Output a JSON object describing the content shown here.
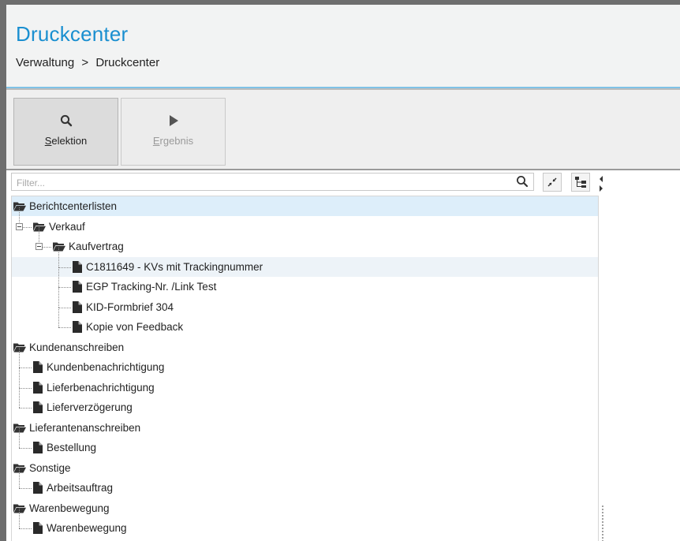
{
  "header": {
    "title": "Druckcenter",
    "breadcrumb": [
      "Verwaltung",
      ">",
      "Druckcenter"
    ]
  },
  "toolbar": {
    "selektion": {
      "underlined": "S",
      "rest": "elektion",
      "icon": "search-icon"
    },
    "ergebnis": {
      "underlined": "E",
      "rest": "rgebnis",
      "icon": "play-icon"
    }
  },
  "filter": {
    "placeholder": "Filter..."
  },
  "tree": {
    "nodes": [
      {
        "id": "berichtcenterlisten",
        "label": "Berichtcenterlisten",
        "type": "folder",
        "level": 0,
        "selected": true
      },
      {
        "id": "verkauf",
        "label": "Verkauf",
        "type": "folder",
        "level": 1,
        "expanded": true
      },
      {
        "id": "kaufvertrag",
        "label": "Kaufvertrag",
        "type": "folder",
        "level": 2,
        "expanded": true
      },
      {
        "id": "c1811649",
        "label": "C1811649 - KVs mit Trackingnummer",
        "type": "doc",
        "level": 3,
        "hover": true
      },
      {
        "id": "egp",
        "label": "EGP Tracking-Nr. /Link Test",
        "type": "doc",
        "level": 3
      },
      {
        "id": "kid",
        "label": "KID-Formbrief 304",
        "type": "doc",
        "level": 3
      },
      {
        "id": "kopie",
        "label": "Kopie von Feedback",
        "type": "doc",
        "level": 3
      },
      {
        "id": "kundenanschreiben",
        "label": "Kundenanschreiben",
        "type": "folder",
        "level": 0
      },
      {
        "id": "kundenbenachrichtigung",
        "label": "Kundenbenachrichtigung",
        "type": "doc",
        "level": 1
      },
      {
        "id": "lieferbenachrichtigung",
        "label": "Lieferbenachrichtigung",
        "type": "doc",
        "level": 1
      },
      {
        "id": "lieferverzoegerung",
        "label": "Lieferverzögerung",
        "type": "doc",
        "level": 1
      },
      {
        "id": "lieferantenanschreiben",
        "label": "Lieferantenanschreiben",
        "type": "folder",
        "level": 0
      },
      {
        "id": "bestellung",
        "label": "Bestellung",
        "type": "doc",
        "level": 1
      },
      {
        "id": "sonstige",
        "label": "Sonstige",
        "type": "folder",
        "level": 0
      },
      {
        "id": "arbeitsauftrag",
        "label": "Arbeitsauftrag",
        "type": "doc",
        "level": 1
      },
      {
        "id": "warenbewegung-folder",
        "label": "Warenbewegung",
        "type": "folder",
        "level": 0
      },
      {
        "id": "warenbewegung-doc",
        "label": "Warenbewegung",
        "type": "doc",
        "level": 1
      }
    ]
  },
  "colors": {
    "accent": "#1a8fd0",
    "selected_row": "#ddeefa",
    "hover_row": "#edf3f8"
  }
}
